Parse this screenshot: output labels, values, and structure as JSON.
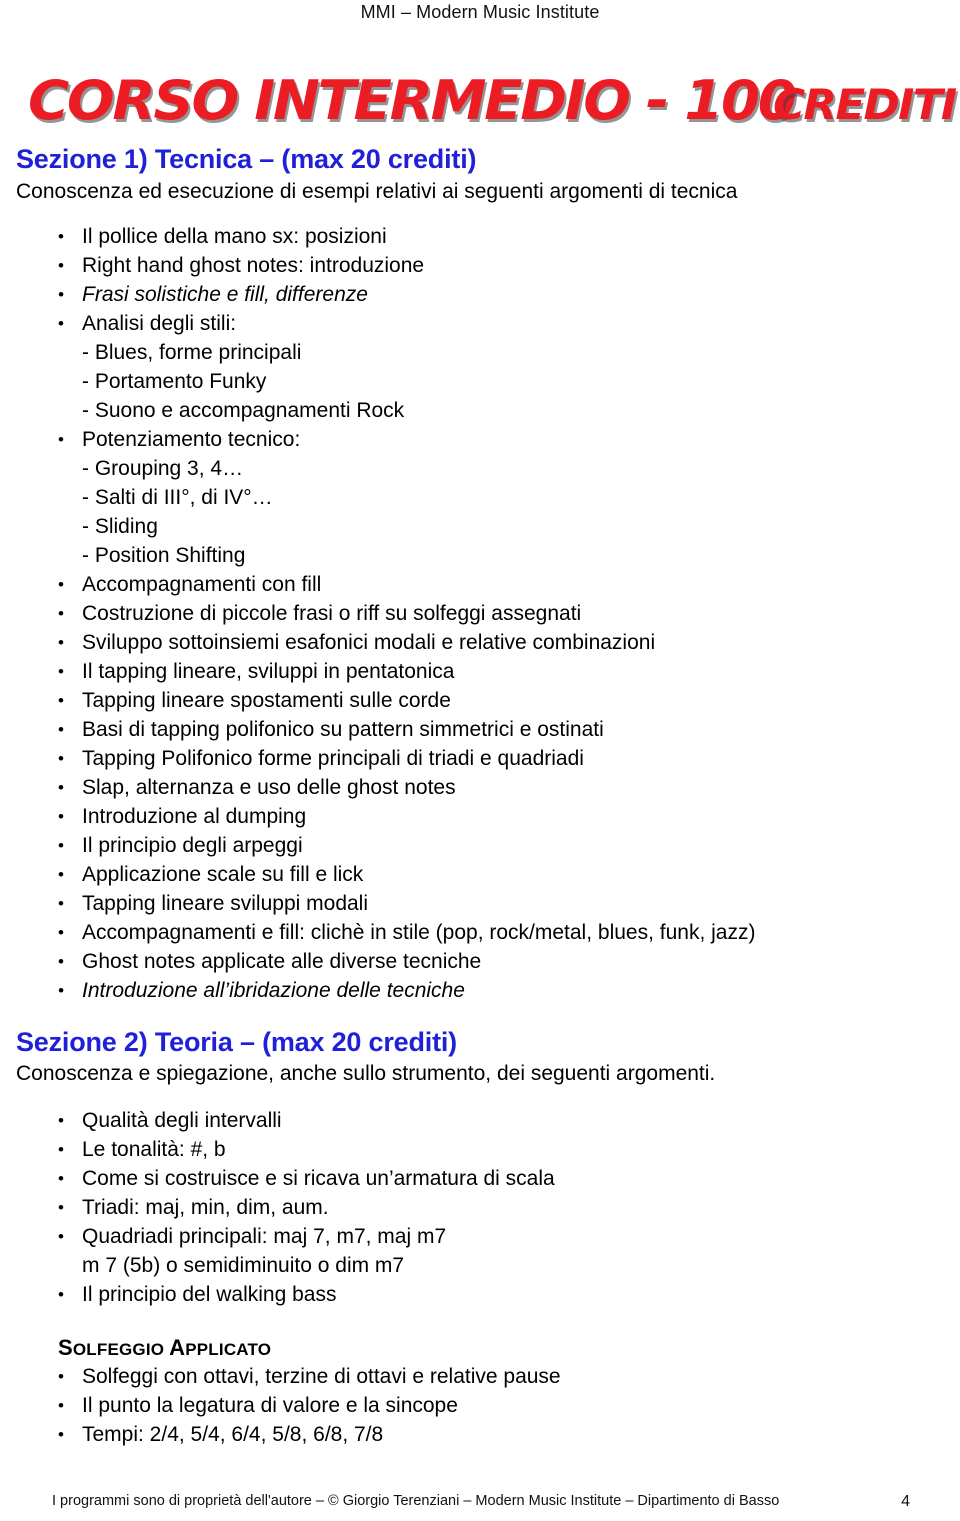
{
  "header": {
    "running_head": "MMI – Modern Music Institute"
  },
  "title": {
    "main": "CORSO INTERMEDIO - 100",
    "tail": "CREDITI",
    "color": "#ec1c24"
  },
  "sections": [
    {
      "heading": "Sezione 1) Tecnica – (max 20 crediti)",
      "heading_color": "#2020d8",
      "subtitle": "Conoscenza ed esecuzione di esempi relativi ai seguenti argomenti di tecnica",
      "items": [
        {
          "kind": "bullet",
          "text": "Il pollice della mano sx: posizioni"
        },
        {
          "kind": "bullet",
          "text": "Right hand ghost notes: introduzione"
        },
        {
          "kind": "bullet",
          "text": "Frasi solistiche e fill, differenze",
          "style": "italic"
        },
        {
          "kind": "bullet",
          "text": "Analisi degli stili:"
        },
        {
          "kind": "sub",
          "text": "- Blues, forme principali"
        },
        {
          "kind": "sub",
          "text": "- Portamento Funky"
        },
        {
          "kind": "sub",
          "text": "- Suono e accompagnamenti Rock"
        },
        {
          "kind": "bullet",
          "text": "Potenziamento tecnico:"
        },
        {
          "kind": "sub",
          "text": "- Grouping 3, 4…"
        },
        {
          "kind": "sub",
          "text": "- Salti di III°, di IV°…"
        },
        {
          "kind": "sub",
          "text": "- Sliding"
        },
        {
          "kind": "sub",
          "text": "- Position Shifting"
        },
        {
          "kind": "bullet",
          "text": "Accompagnamenti con fill"
        },
        {
          "kind": "bullet",
          "text": "Costruzione di piccole frasi o riff su solfeggi assegnati"
        },
        {
          "kind": "bullet",
          "text": "Sviluppo sottoinsiemi esafonici modali e relative combinazioni"
        },
        {
          "kind": "bullet",
          "text": "Il tapping lineare, sviluppi in pentatonica"
        },
        {
          "kind": "bullet",
          "text": "Tapping lineare spostamenti sulle corde"
        },
        {
          "kind": "bullet",
          "text": "Basi di tapping polifonico su pattern simmetrici e ostinati"
        },
        {
          "kind": "bullet",
          "text": "Tapping Polifonico forme principali di triadi e quadriadi"
        },
        {
          "kind": "bullet",
          "text": "Slap, alternanza e uso delle ghost notes"
        },
        {
          "kind": "bullet",
          "text": "Introduzione al dumping"
        },
        {
          "kind": "bullet",
          "text": "Il principio degli arpeggi"
        },
        {
          "kind": "bullet",
          "text": "Applicazione scale su fill e lick"
        },
        {
          "kind": "bullet",
          "text": "Tapping lineare sviluppi modali"
        },
        {
          "kind": "bullet",
          "text": "Accompagnamenti e fill: clichè in stile (pop, rock/metal, blues, funk, jazz)"
        },
        {
          "kind": "bullet",
          "text": "Ghost notes applicate alle diverse tecniche"
        },
        {
          "kind": "bullet",
          "text": "Introduzione all’ibridazione delle tecniche",
          "style": "italic"
        }
      ]
    },
    {
      "heading": "Sezione 2) Teoria – (max 20 crediti)",
      "heading_color": "#2020d8",
      "subtitle": "Conoscenza e spiegazione, anche sullo strumento, dei seguenti argomenti.",
      "items": [
        {
          "kind": "bullet",
          "text": "Qualità degli intervalli"
        },
        {
          "kind": "bullet",
          "text": "Le tonalità: #, b"
        },
        {
          "kind": "bullet",
          "text": "Come si costruisce e si ricava un’armatura di scala"
        },
        {
          "kind": "bullet",
          "text": "Triadi: maj, min, dim, aum."
        },
        {
          "kind": "bullet",
          "text": "Quadriadi principali: maj 7, m7, maj m7"
        },
        {
          "kind": "cont",
          "text": "m 7 (5b) o semidiminuito o dim m7"
        },
        {
          "kind": "bullet",
          "text": "Il principio del walking bass"
        }
      ],
      "subsection": {
        "label_cap1": "S",
        "label_rest1": "OLFEGGIO",
        "label_cap2": "A",
        "label_rest2": "PPLICATO",
        "items": [
          {
            "kind": "bullet",
            "text": "Solfeggi con ottavi, terzine di ottavi e relative pause"
          },
          {
            "kind": "bullet",
            "text": "Il punto la legatura di valore e la sincope"
          },
          {
            "kind": "bullet",
            "text": "Tempi: 2/4, 5/4, 6/4, 5/8, 6/8, 7/8"
          }
        ]
      }
    }
  ],
  "footer": {
    "text": "I programmi sono di proprietà dell'autore – © Giorgio Terenziani – Modern Music Institute – Dipartimento di  Basso",
    "page_number": "4"
  }
}
